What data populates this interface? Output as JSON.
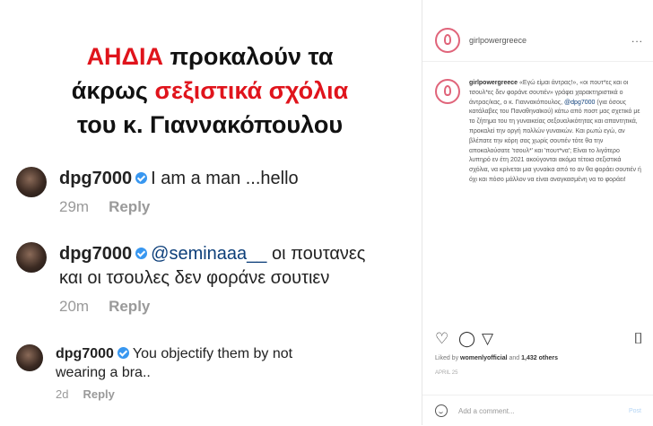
{
  "left": {
    "headline": {
      "line1_red": "ΑΗΔΙΑ",
      "line1_rest": "προκαλούν τα",
      "line2_start": "άκρως",
      "line2_red": "σεξιστικά σχόλια",
      "line3": "του κ. Γιαννακόπουλου"
    },
    "comments": [
      {
        "user": "dpg7000",
        "text": "I am a man ...hello",
        "mention": "",
        "time": "29m",
        "reply": "Reply"
      },
      {
        "user": "dpg7000",
        "mention": "@seminaaa__",
        "text": "οι πουτανες",
        "text2": "και οι τσουλες δεν φοράνε σουτιεν",
        "time": "20m",
        "reply": "Reply"
      },
      {
        "user": "dpg7000",
        "text": "You objectify them by not",
        "text2": "wearing a bra..",
        "mention": "",
        "time": "2d",
        "reply": "Reply"
      }
    ]
  },
  "right": {
    "header": {
      "username": "girlpowergreece",
      "more": "..."
    },
    "caption": {
      "username": "girlpowergreece",
      "text1": "«Εγώ είμαι άντρας!», «οι πουτ*ες και οι τσουλ*ες δεν φοράνε σουτιέν» γράφει χαρακτηριστικά ο άντρας/κας, ο κ. Γιαννακόπουλος,",
      "mention": "@dpg7000",
      "text2": "(για όσους κατάλαβες του Παναθηναϊκού) κάτω από ποστ μας σχετικό με το ζήτημα του τη γυναικείας σεξουαλικότητας και απαντητικά, προκαλεί την οργή πολλών γυναικών. Και ρωτώ εγώ, αν βλέπατε την κόρη σας χωρίς σουτιέν τότε θα την αποκαλούσατε 'τσουλ*' και 'πουτ*να'; Είναι το λιγότερο λυπηρό εν έτη 2021 ακούγονται ακόμα τέτοια σεξιστικά σχόλια, να κρίνεται μια γυναίκα από το αν θα φοράει σουτιέν ή όχι και πόσο μάλλον να είναι αναγκασμένη να το φοράει!"
    },
    "likes": {
      "prefix": "Liked by",
      "user": "womenlyofficial",
      "middle": "and",
      "count": "1,432 others"
    },
    "date": "APRIL 25",
    "add_comment": {
      "placeholder": "Add a comment...",
      "post": "Post"
    }
  }
}
